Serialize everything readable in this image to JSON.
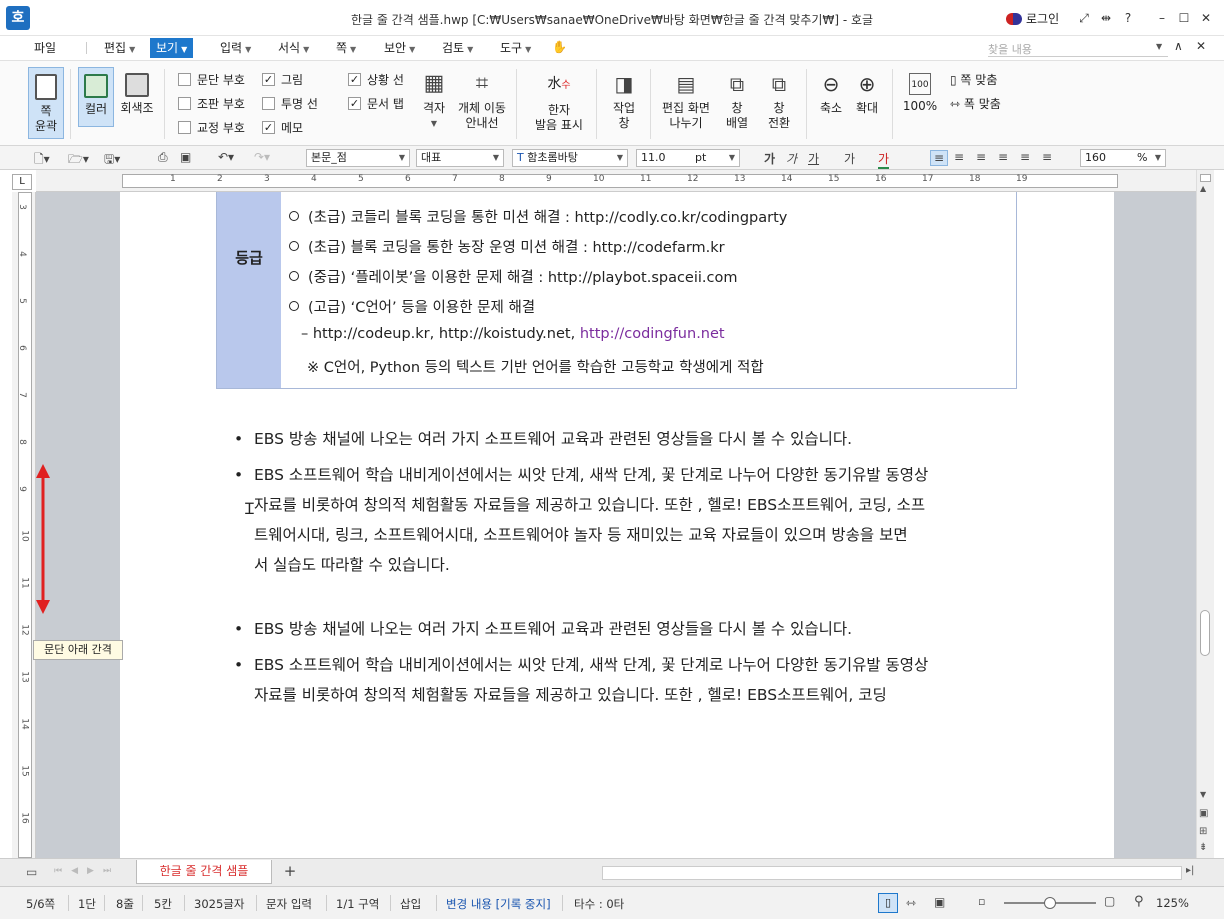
{
  "window": {
    "app_icon": "호",
    "title": "한글 줄 간격 샘플.hwp [C:₩Users₩sanae₩OneDrive₩바탕 화면₩한글 줄 간격 맞추기₩] - 호글",
    "login": "로그인",
    "controls": {
      "help": "?",
      "minimize": "–",
      "maximize": "☐",
      "close": "✕"
    }
  },
  "menu": {
    "items": [
      "파일",
      "편집",
      "보기",
      "입력",
      "서식",
      "쪽",
      "보안",
      "검토",
      "도구"
    ],
    "active": "보기",
    "find_placeholder": "찾을 내용"
  },
  "ribbon": {
    "page_outline": [
      "쪽",
      "윤곽"
    ],
    "color": "컬러",
    "grayscale": "회색조",
    "checks_col1": [
      {
        "label": "문단 부호",
        "checked": false
      },
      {
        "label": "조판 부호",
        "checked": false
      },
      {
        "label": "교정 부호",
        "checked": false
      }
    ],
    "checks_col2": [
      {
        "label": "그림",
        "checked": true
      },
      {
        "label": "투명 선",
        "checked": false
      },
      {
        "label": "메모",
        "checked": true
      }
    ],
    "checks_col3": [
      {
        "label": "상황 선",
        "checked": true
      },
      {
        "label": "문서 탭",
        "checked": true
      }
    ],
    "grid": "격자",
    "object_guides": [
      "개체 이동",
      "안내선"
    ],
    "hanja": [
      "한자",
      "발음 표시"
    ],
    "work_window": [
      "작업",
      "창"
    ],
    "edit_split": [
      "편집 화면",
      "나누기"
    ],
    "window_arrange": [
      "창",
      "배열"
    ],
    "window_switch": [
      "창",
      "전환"
    ],
    "zoom_out": "축소",
    "zoom_in": "확대",
    "zoom_100": "100%",
    "fit_page": "쪽 맞춤",
    "fit_width": "폭 맞춤"
  },
  "format": {
    "style": "본문_점",
    "lang": "대표",
    "font": "함초롬바탕",
    "size": "11.0",
    "size_unit": "pt",
    "bold": "가",
    "italic": "가",
    "underline": "가",
    "strike": "가",
    "color_char": "가",
    "zoom": "160",
    "zoom_unit": "%"
  },
  "ruler": {
    "h_ticks": [
      "1",
      "2",
      "3",
      "4",
      "5",
      "6",
      "7",
      "8",
      "9",
      "10",
      "11",
      "12",
      "13",
      "14",
      "15",
      "16",
      "17",
      "18",
      "19"
    ],
    "v_ticks": [
      "3",
      "4",
      "5",
      "6",
      "7",
      "8",
      "9",
      "10",
      "11",
      "12",
      "13",
      "14",
      "15",
      "16"
    ]
  },
  "document": {
    "table_head": "등급",
    "table_lines": [
      "(초급) 코들리 블록 코딩을 통한 미션 해결 : http://codly.co.kr/codingparty",
      "(초급) 블록 코딩을 통한 농장 운영 미션 해결 : http://codefarm.kr",
      "(중급) ‘플레이봇’을 이용한 문제 해결 : http://playbot.spaceii.com",
      "(고급) ‘C언어’ 등을 이용한 문제 해결"
    ],
    "table_sub_prefix": "– http://codeup.kr, http://koistudy.net, ",
    "table_sub_link": "http://codingfun.net",
    "table_note": "※ C언어, Python 등의 텍스트 기반 언어를 학습한 고등학교 학생에게 적합",
    "bullet": "•",
    "block1": {
      "p1": "EBS 방송 채널에 나오는 여러 가지 소프트웨어 교육과 관련된 영상들을 다시 볼 수 있습니다.",
      "p2_lines": [
        "EBS 소프트웨어 학습 내비게이션에서는 씨앗 단계, 새싹 단계, 꽃 단계로 나누어 다양한 동기유발 동영상",
        "자료를 비롯하여 창의적 체험활동 자료들을 제공하고 있습니다. 또한 , 헬로! EBS소프트웨어, 코딩, 소프",
        "트웨어시대, 링크, 소프트웨어시대, 소프트웨어야 놀자 등 재미있는 교육 자료들이 있으며 방송을 보면",
        "서 실습도 따라할 수 있습니다."
      ]
    },
    "block2": {
      "p1": "EBS 방송 채널에 나오는 여러 가지 소프트웨어 교육과 관련된 영상들을 다시 볼 수 있습니다.",
      "p2_lines": [
        "EBS 소프트웨어 학습 내비게이션에서는 씨앗 단계, 새싹 단계, 꽃 단계로 나누어 다양한 동기유발 동영상",
        "자료를 비롯하여 창의적 체험활동 자료들을 제공하고 있습니다. 또한 , 헬로! EBS소프트웨어, 코딩"
      ]
    },
    "tooltip": "문단 아래 간격"
  },
  "tabs": {
    "doc_tab": "한글 줄 간격 샘플",
    "add": "+"
  },
  "status": {
    "page": "5/6쪽",
    "col": "1단",
    "line": "8줄",
    "ch": "5칸",
    "chars": "3025글자",
    "mode": "문자 입력",
    "section": "1/1 구역",
    "insert": "삽입",
    "track": "변경 내용 [기록 중지]",
    "typos": "타수 : 0타",
    "zoom": "125%"
  },
  "colors": {
    "accent": "#1e78cc",
    "table_head_bg": "#b9c8ec",
    "link_purple": "#7b2d9e",
    "arrow_red": "#e02020",
    "tab_red": "#d82e2e"
  }
}
